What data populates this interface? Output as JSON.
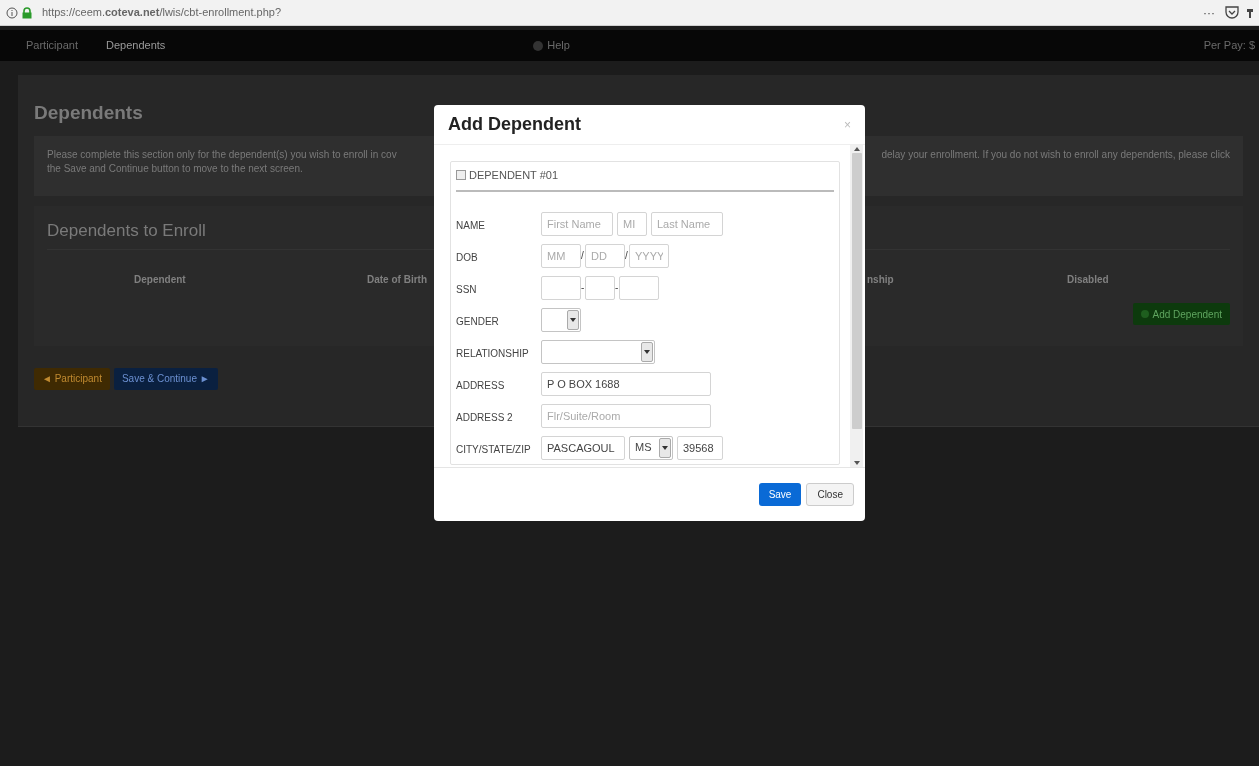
{
  "browser": {
    "url": "https://ceem.**coteva.net**/lwis/cbt-enrollment.php?",
    "menu": "···"
  },
  "nav": {
    "items": [
      {
        "label": "Participant",
        "selected": false
      },
      {
        "label": "Dependents",
        "selected": true
      }
    ],
    "help": "Help",
    "right": "Per Pay: $"
  },
  "page": {
    "title": "Dependents",
    "intro_left": "Please complete this section only for the dependent(s) you wish to enroll in cov",
    "intro_right": "delay your enrollment. If you do not wish to enroll any dependents, please click",
    "intro_line2": "the Save and Continue button to move to the next screen.",
    "section_title": "Dependents to Enroll",
    "columns": [
      "Dependent",
      "Date of Birth",
      "nship",
      "Disabled"
    ],
    "add_button": "Add Dependent",
    "back_button": "◄ Participant",
    "next_button": "Save & Continue ►"
  },
  "modal": {
    "title": "Add Dependent",
    "close": "×",
    "dependent": {
      "label": "DEPENDENT #01",
      "checked": false
    },
    "rows": [
      {
        "label": "NAME",
        "fields": [
          {
            "kind": "input",
            "placeholder": "First Name"
          },
          {
            "kind": "input",
            "placeholder": "MI"
          },
          {
            "kind": "input",
            "placeholder": "Last Name"
          }
        ]
      },
      {
        "label": "DOB",
        "separator": "/",
        "fields": [
          {
            "kind": "input",
            "placeholder": "MM"
          },
          {
            "kind": "input",
            "placeholder": "DD"
          },
          {
            "kind": "input",
            "placeholder": "YYYY"
          }
        ]
      },
      {
        "label": "SSN",
        "separator": "-",
        "fields": [
          {
            "kind": "input"
          },
          {
            "kind": "input"
          },
          {
            "kind": "input"
          }
        ]
      },
      {
        "label": "GENDER",
        "fields": [
          {
            "kind": "select"
          }
        ]
      },
      {
        "label": "RELATIONSHIP",
        "fields": [
          {
            "kind": "select"
          }
        ]
      },
      {
        "label": "ADDRESS",
        "fields": [
          {
            "kind": "input",
            "value": "P O BOX 1688"
          }
        ]
      },
      {
        "label": "ADDRESS 2",
        "fields": [
          {
            "kind": "input",
            "placeholder": "Flr/Suite/Room"
          }
        ]
      },
      {
        "label": "CITY/STATE/ZIP",
        "fields": [
          {
            "kind": "input",
            "value": "PASCAGOUL"
          },
          {
            "kind": "select",
            "value": "MS"
          },
          {
            "kind": "input",
            "value": "39568"
          }
        ]
      }
    ],
    "save": "Save",
    "close_button": "Close"
  }
}
